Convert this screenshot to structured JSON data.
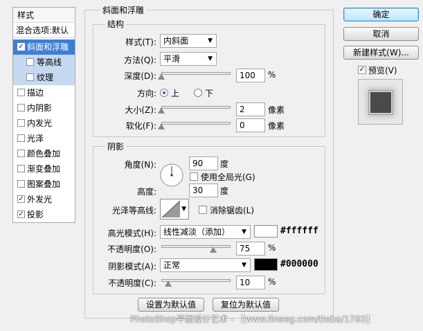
{
  "sidebar": {
    "header": "样式",
    "blend": "混合选项:默认",
    "items": [
      {
        "label": "斜面和浮雕",
        "checked": true,
        "selected": true
      },
      {
        "label": "等高线",
        "checked": false,
        "sub": true
      },
      {
        "label": "纹理",
        "checked": false,
        "sub": true
      },
      {
        "label": "描边",
        "checked": false
      },
      {
        "label": "内阴影",
        "checked": false
      },
      {
        "label": "内发光",
        "checked": false
      },
      {
        "label": "光泽",
        "checked": false
      },
      {
        "label": "颜色叠加",
        "checked": false
      },
      {
        "label": "渐变叠加",
        "checked": false
      },
      {
        "label": "图案叠加",
        "checked": false
      },
      {
        "label": "外发光",
        "checked": true
      },
      {
        "label": "投影",
        "checked": true
      }
    ],
    "check_mark": "✓"
  },
  "panel": {
    "title": "斜面和浮雕",
    "structure": {
      "title": "结构",
      "style_label": "样式(T):",
      "style_value": "内斜面",
      "technique_label": "方法(Q):",
      "technique_value": "平滑",
      "depth_label": "深度(D):",
      "depth_value": "100",
      "depth_unit": "%",
      "depth_level": 0.0,
      "direction_label": "方向:",
      "direction_up": "上",
      "direction_down": "下",
      "size_label": "大小(Z):",
      "size_value": "2",
      "size_unit": "像素",
      "size_level": 0.0,
      "soften_label": "软化(F):",
      "soften_value": "0",
      "soften_unit": "像素",
      "soften_level": 0.0
    },
    "shading": {
      "title": "阴影",
      "angle_label": "角度(N):",
      "angle_value": "90",
      "angle_unit": "度",
      "global_light_label": "使用全局光(G)",
      "altitude_label": "高度:",
      "altitude_value": "30",
      "altitude_unit": "度",
      "gloss_label": "光泽等高线:",
      "anti_alias_label": "消除锯齿(L)",
      "highlight_mode_label": "高光模式(H):",
      "highlight_mode_value": "线性减淡（添加）",
      "highlight_color": "#ffffff",
      "highlight_hex": "#ffffff",
      "highlight_opacity_label": "不透明度(O):",
      "highlight_opacity_value": "75",
      "highlight_opacity_level": 0.75,
      "opacity_unit": "%",
      "shadow_mode_label": "阴影模式(A):",
      "shadow_mode_value": "正常",
      "shadow_color": "#000000",
      "shadow_hex": "#000000",
      "shadow_opacity_label": "不透明度(C):",
      "shadow_opacity_value": "10",
      "shadow_opacity_level": 0.1
    },
    "make_default": "设置为默认值",
    "reset_default": "复位为默认值"
  },
  "right": {
    "ok": "确定",
    "cancel": "取消",
    "new_style": "新建样式(W)...",
    "preview_label": "预览(V)"
  },
  "watermark": "PhotoShop平面设计艺术 - 【www.lineeg.com/tieba/1783】",
  "colors": {
    "selected": "#3d7fd6",
    "sub_selected": "#c5d9f1"
  }
}
